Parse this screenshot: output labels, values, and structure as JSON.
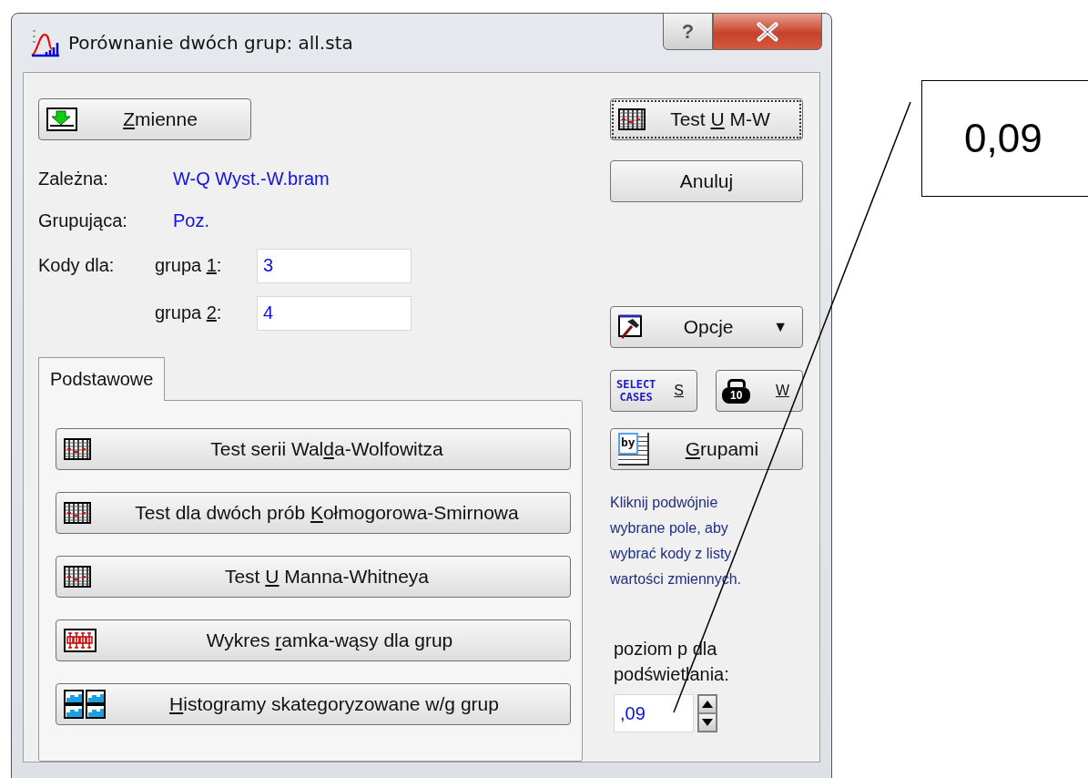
{
  "window": {
    "title": "Porównanie dwóch grup: all.sta",
    "help_glyph": "?"
  },
  "variables_button": {
    "key": "Z",
    "post": "mienne"
  },
  "info_rows": [
    {
      "label": "Zależna:",
      "value": "W-Q Wyst.-W.bram"
    },
    {
      "label": "Grupująca:",
      "value": "Poz."
    }
  ],
  "codes": {
    "label": "Kody dla:",
    "fields": [
      {
        "pre": "grupa ",
        "key": "1",
        "post": ":",
        "value": "3"
      },
      {
        "pre": "grupa ",
        "key": "2",
        "post": ":",
        "value": "4"
      }
    ]
  },
  "tabs": [
    {
      "label": "Podstawowe",
      "selected": true
    }
  ],
  "tests": [
    {
      "kind": "table",
      "pre": "Test serii Wal",
      "key": "d",
      "post": "a-Wolfowitza"
    },
    {
      "kind": "table",
      "pre": "Test dla dwóch prób ",
      "key": "K",
      "post": "ołmogorowa-Smirnowa"
    },
    {
      "kind": "table",
      "pre": "Test ",
      "key": "U",
      "post": " Manna-Whitneya"
    },
    {
      "kind": "boxplot",
      "pre": "Wykres ",
      "key": "r",
      "post": "amka-wąsy dla grup"
    },
    {
      "kind": "histograms",
      "key": "H",
      "post": "istogramy skategoryzowane w/g grup"
    }
  ],
  "ok_button": {
    "pre": "Test ",
    "key": "U",
    "post": " M-W",
    "focused": true
  },
  "cancel_button": {
    "label": "Anuluj"
  },
  "options_button": {
    "label": "Opcje",
    "caret": "▼"
  },
  "select_button": {
    "icon_top": "SELECT",
    "icon_bottom": "CASES",
    "key": "S"
  },
  "weight_button": {
    "icon_text": "10",
    "key": "W"
  },
  "by_button": {
    "icon_text": "by",
    "key": "G",
    "post": "rupami"
  },
  "hint": "Kliknij podwójnie wybrane pole, aby wybrać kody z listy wartości  zmiennych.",
  "p_level": {
    "label": "poziom p dla podświetlania:",
    "value": ",09"
  },
  "callout": {
    "text": "0,09"
  }
}
